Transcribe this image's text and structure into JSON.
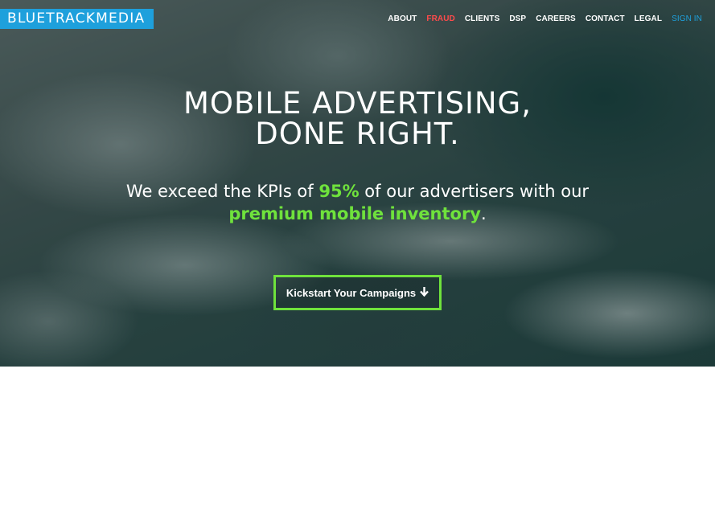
{
  "brand": {
    "logo_text": "BLUETRACKMEDIA",
    "logo_color": "#1ea0dc"
  },
  "nav": {
    "items": [
      {
        "label": "ABOUT"
      },
      {
        "label": "FRAUD",
        "color": "#ff4b4b"
      },
      {
        "label": "CLIENTS"
      },
      {
        "label": "DSP"
      },
      {
        "label": "CAREERS"
      },
      {
        "label": "CONTACT"
      },
      {
        "label": "LEGAL"
      },
      {
        "label": "SIGN IN",
        "color": "#1ea0dc"
      }
    ]
  },
  "hero": {
    "headline_line1": "MOBILE ADVERTISING,",
    "headline_line2": "DONE RIGHT.",
    "sub_part1": "We exceed the KPIs of ",
    "sub_highlight1": "95%",
    "sub_part2": " of our advertisers with our",
    "sub_highlight2": "premium mobile inventory",
    "sub_part3": ".",
    "highlight_color": "#6fe23c",
    "cta_label": "Kickstart Your Campaigns",
    "cta_icon": "arrow-down-icon"
  }
}
